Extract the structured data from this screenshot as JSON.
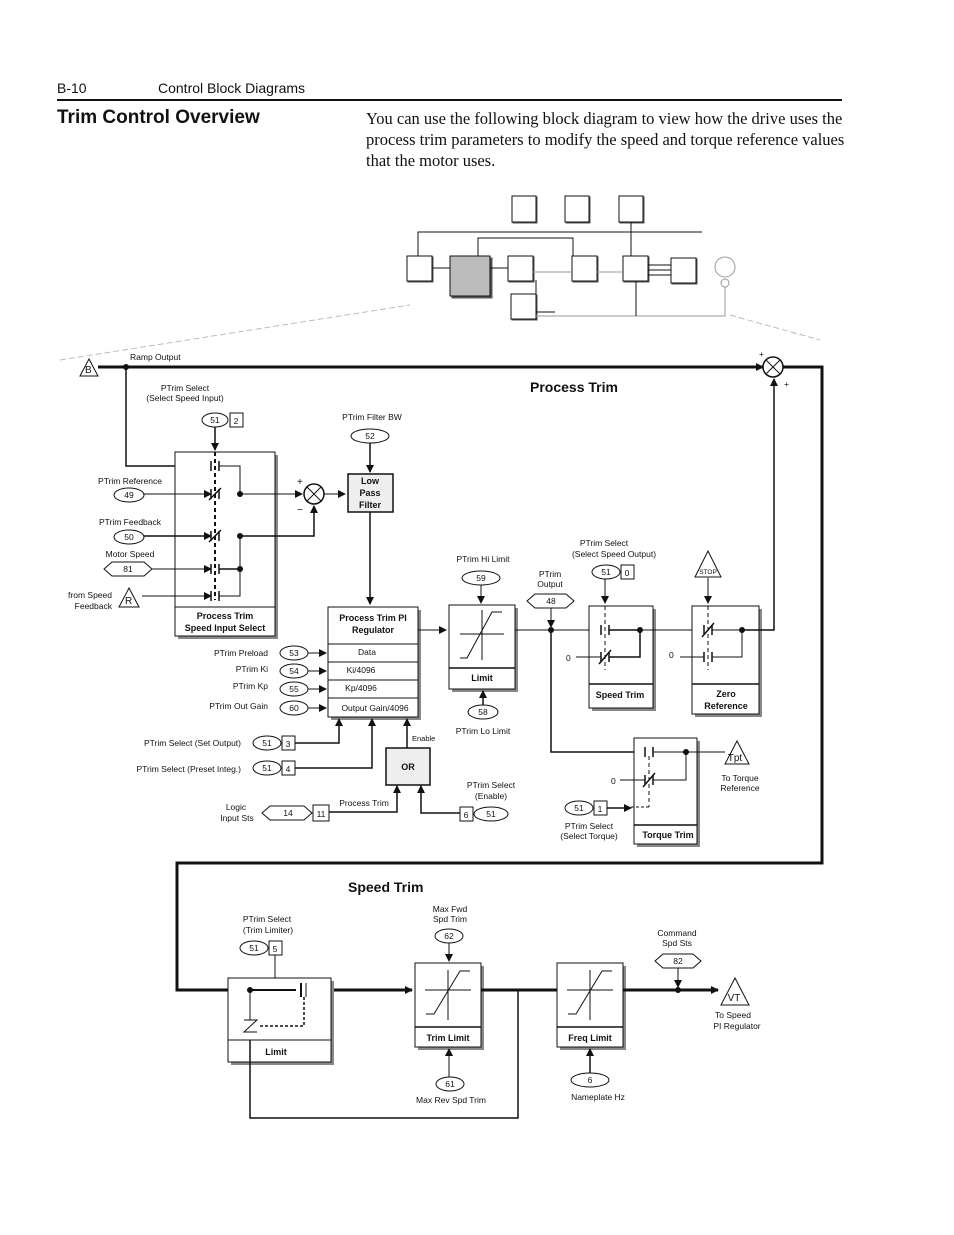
{
  "header": {
    "page_number": "B-10",
    "chapter_title": "Control Block Diagrams"
  },
  "section": {
    "title": "Trim Control Overview",
    "intro": "You can use the following block diagram to view how the drive uses the process trim parameters to modify the speed and torque reference values that the motor uses."
  },
  "diagram": {
    "process_trim_title": "Process Trim",
    "speed_trim_title": "Speed Trim",
    "ramp_output": {
      "label": "Ramp Output",
      "connector": "B"
    },
    "ptrim_select_speed_input": {
      "label1": "PTrim Select",
      "label2": "(Select Speed Input)",
      "param": "51",
      "bit": "2"
    },
    "ptrim_reference": {
      "label": "PTrim Reference",
      "param": "49"
    },
    "ptrim_feedback": {
      "label": "PTrim Feedback",
      "param": "50"
    },
    "motor_speed": {
      "label": "Motor Speed",
      "param": "81"
    },
    "speed_feedback": {
      "label1": "from Speed",
      "label2": "Feedback",
      "connector": "R"
    },
    "input_select_block": {
      "line1": "Process Trim",
      "line2": "Speed Input Select"
    },
    "summer": {
      "plus": "+",
      "minus": "−"
    },
    "filter_bw": {
      "label": "PTrim Filter BW",
      "param": "52"
    },
    "low_pass_filter": {
      "line1": "Low",
      "line2": "Pass",
      "line3": "Filter"
    },
    "pi_regulator": {
      "line1": "Process Trim PI",
      "line2": "Regulator",
      "rows": [
        "Data",
        "Ki/4096",
        "Kp/4096",
        "Output Gain/4096"
      ]
    },
    "pi_inputs": [
      {
        "label": "PTrim Preload",
        "param": "53"
      },
      {
        "label": "PTrim Ki",
        "param": "54"
      },
      {
        "label": "PTrim Kp",
        "param": "55"
      },
      {
        "label": "PTrim Out Gain",
        "param": "60"
      }
    ],
    "set_output": {
      "label": "PTrim Select (Set Output)",
      "param": "51",
      "bit": "3"
    },
    "preset_integ": {
      "label": "PTrim Select (Preset Integ.)",
      "param": "51",
      "bit": "4"
    },
    "or_block": {
      "label": "OR",
      "enable": "Enable"
    },
    "logic_input": {
      "label1": "Logic",
      "label2": "Input Sts",
      "param": "14",
      "bit": "11",
      "wire_label": "Process Trim"
    },
    "ptrim_enable": {
      "label1": "PTrim Select",
      "label2": "(Enable)",
      "param": "51",
      "bit": "6"
    },
    "hi_limit": {
      "label": "PTrim Hi Limit",
      "param": "59"
    },
    "lo_limit": {
      "label": "PTrim Lo Limit",
      "param": "58"
    },
    "limit_block": {
      "label": "Limit"
    },
    "ptrim_output": {
      "label1": "PTrim",
      "label2": "Output",
      "param": "48"
    },
    "select_speed_output": {
      "label1": "PTrim Select",
      "label2": "(Select Speed Output)",
      "param": "51",
      "bit": "0"
    },
    "speed_trim_block": {
      "label": "Speed Trim",
      "zero": "0"
    },
    "stop": {
      "label": "STOP"
    },
    "zero_reference_block": {
      "line1": "Zero",
      "line2": "Reference",
      "zero": "0"
    },
    "sum_out": {
      "plus1": "+",
      "plus2": "+"
    },
    "torque_trim_block": {
      "label": "Torque Trim",
      "zero": "0"
    },
    "select_torque": {
      "label1": "PTrim Select",
      "label2": "(Select Torque)",
      "param": "51",
      "bit": "1"
    },
    "torque_ref": {
      "connector": "Tpt",
      "label1": "To Torque",
      "label2": "Reference"
    },
    "trim_limiter": {
      "label1": "PTrim Select",
      "label2": "(Trim Limiter)",
      "param": "51",
      "bit": "5"
    },
    "limit2_block": {
      "label": "Limit"
    },
    "trim_limit_block": {
      "label": "Trim Limit"
    },
    "max_fwd": {
      "label1": "Max Fwd",
      "label2": "Spd Trim",
      "param": "62"
    },
    "max_rev": {
      "label": "Max Rev Spd Trim",
      "param": "61"
    },
    "freq_limit_block": {
      "label": "Freq Limit"
    },
    "nameplate_hz": {
      "label": "Nameplate Hz",
      "param": "6"
    },
    "command_spd": {
      "label1": "Command",
      "label2": "Spd Sts",
      "param": "82"
    },
    "speed_pi": {
      "connector": "VT",
      "label1": "To Speed",
      "label2": "PI Regulator"
    }
  }
}
